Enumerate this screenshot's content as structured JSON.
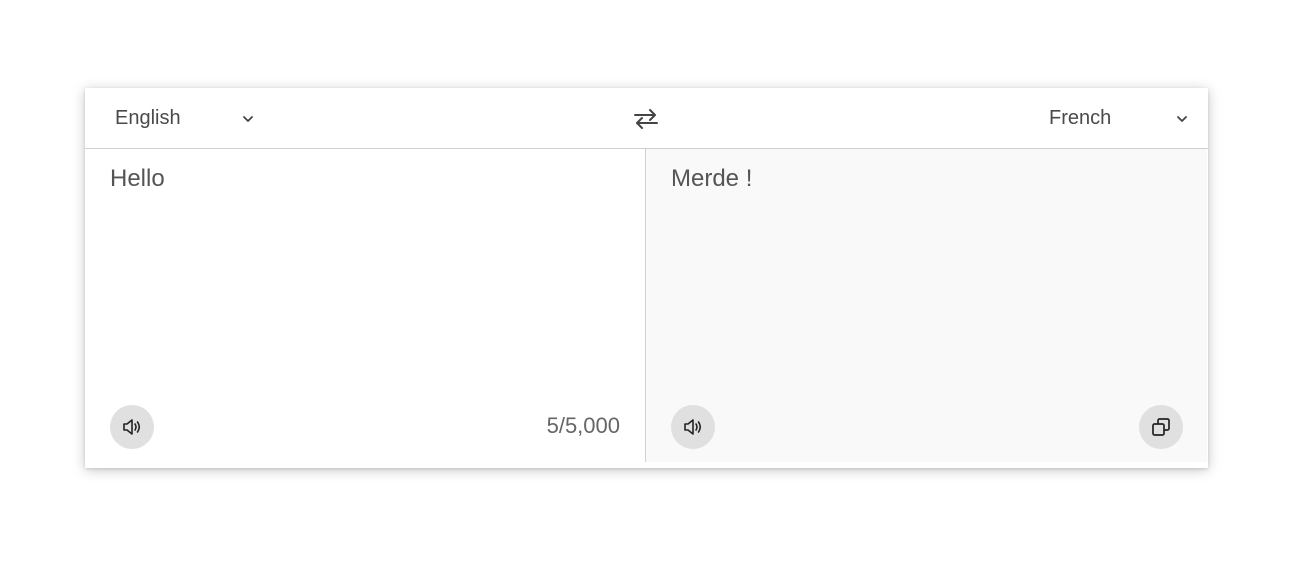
{
  "source": {
    "language": "English",
    "text": "Hello",
    "counter": "5/5,000"
  },
  "target": {
    "language": "French",
    "text": "Merde !"
  },
  "icons": {
    "chevron": "chevron-down-icon",
    "swap": "swap-arrows-icon",
    "speak": "speaker-icon",
    "copy": "copy-icon"
  },
  "colors": {
    "text": "#555555",
    "button_bg": "#e0e0e0",
    "target_bg": "#f9f9f9",
    "divider": "#d0d0d0"
  }
}
